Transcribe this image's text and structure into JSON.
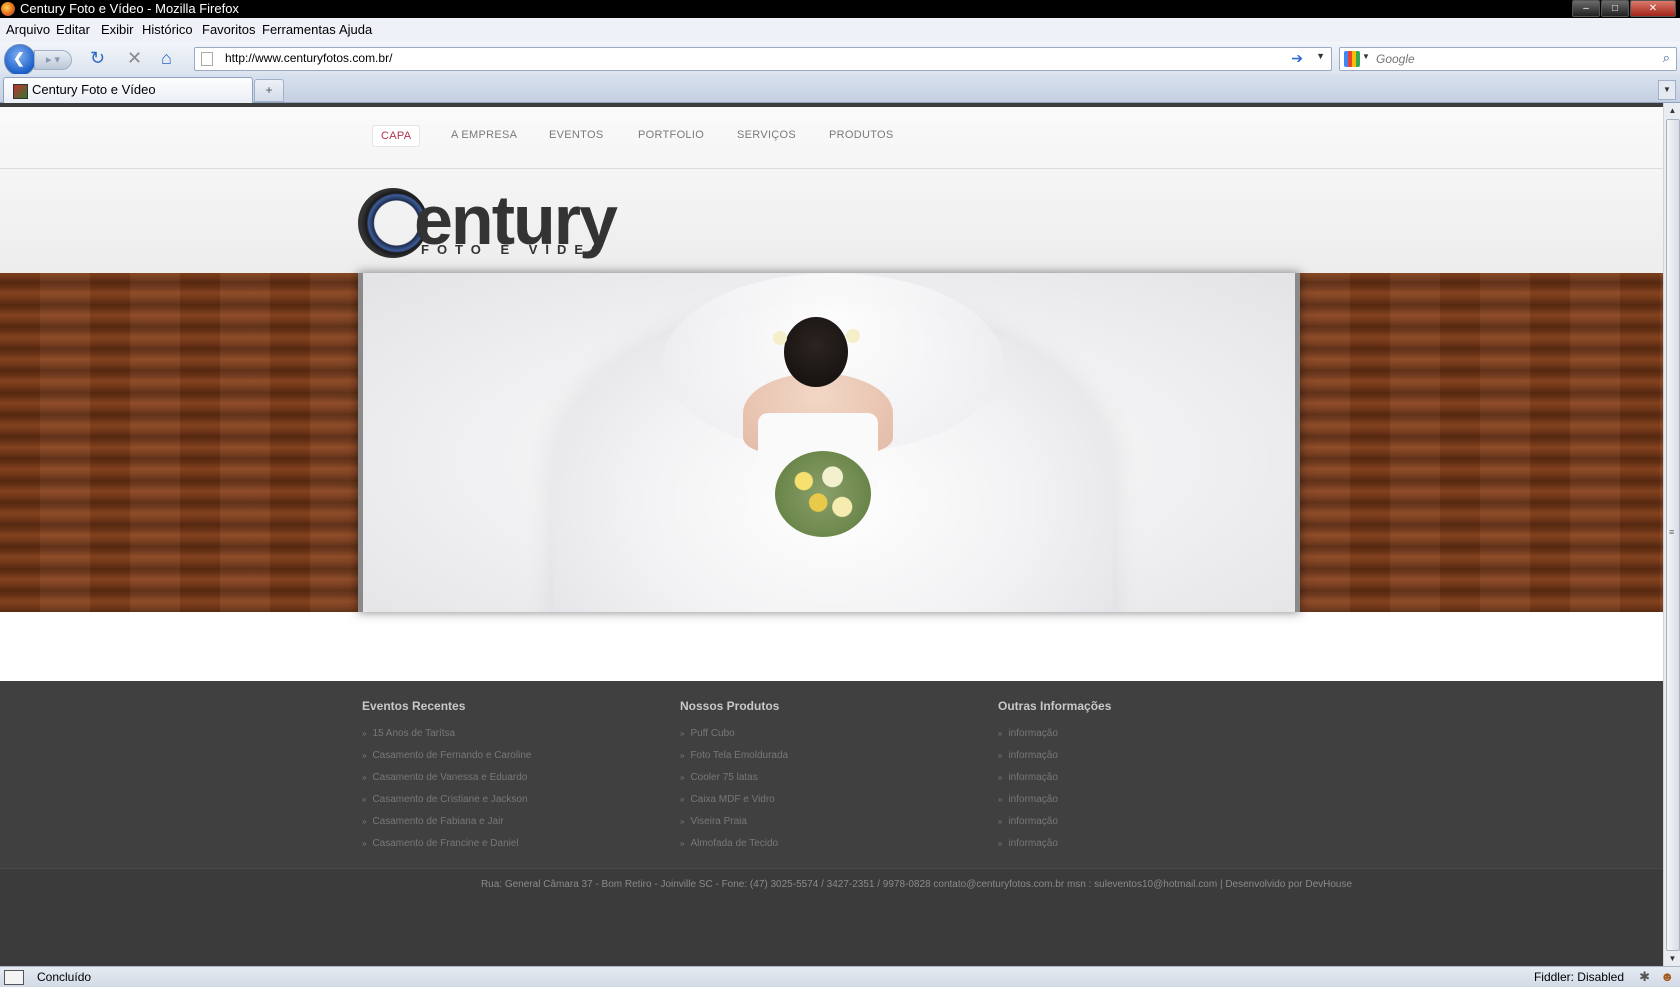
{
  "window": {
    "title": "Century Foto e Vídeo - Mozilla Firefox",
    "buttons": {
      "minimize": "–",
      "maximize": "□",
      "close": "✕"
    }
  },
  "menu": [
    "Arquivo",
    "Editar",
    "Exibir",
    "Histórico",
    "Favoritos",
    "Ferramentas",
    "Ajuda"
  ],
  "navbar": {
    "url": "http://www.centuryfotos.com.br/",
    "search_placeholder": "Google"
  },
  "tabs": {
    "active_label": "Century Foto e Vídeo",
    "new_tab": "+"
  },
  "site": {
    "nav": [
      "CAPA",
      "A EMPRESA",
      "EVENTOS",
      "PORTFOLIO",
      "SERVIÇOS",
      "PRODUTOS"
    ],
    "active_nav": "CAPA",
    "logo_word": "entury",
    "logo_tag": "FOTO E VÍDEO",
    "footer": {
      "col1": {
        "title": "Eventos Recentes",
        "items": [
          "15 Anos de Tarítsa",
          "Casamento de Fernando e Caroline",
          "Casamento de Vanessa e Eduardo",
          "Casamento de Cristiane e Jackson",
          "Casamento de Fabiana e Jair",
          "Casamento de Francine e Daniel"
        ]
      },
      "col2": {
        "title": "Nossos Produtos",
        "items": [
          "Puff Cubo",
          "Foto Tela Emoldurada",
          "Cooler 75 latas",
          "Caixa MDF e Vidro",
          "Viseira Praia",
          "Almofada de Tecido"
        ]
      },
      "col3": {
        "title": "Outras Informações",
        "items": [
          "informação",
          "informação",
          "informação",
          "informação",
          "informação",
          "informação"
        ]
      },
      "bottom": "Rua: General Câmara 37 - Bom Retiro - Joinville SC - Fone: (47) 3025-5574 / 3427-2351 / 9978-0828 contato@centuryfotos.com.br msn : suleventos10@hotmail.com | Desenvolvido por DevHouse"
    }
  },
  "statusbar": {
    "status": "Concluído",
    "fiddler": "Fiddler: Disabled"
  }
}
